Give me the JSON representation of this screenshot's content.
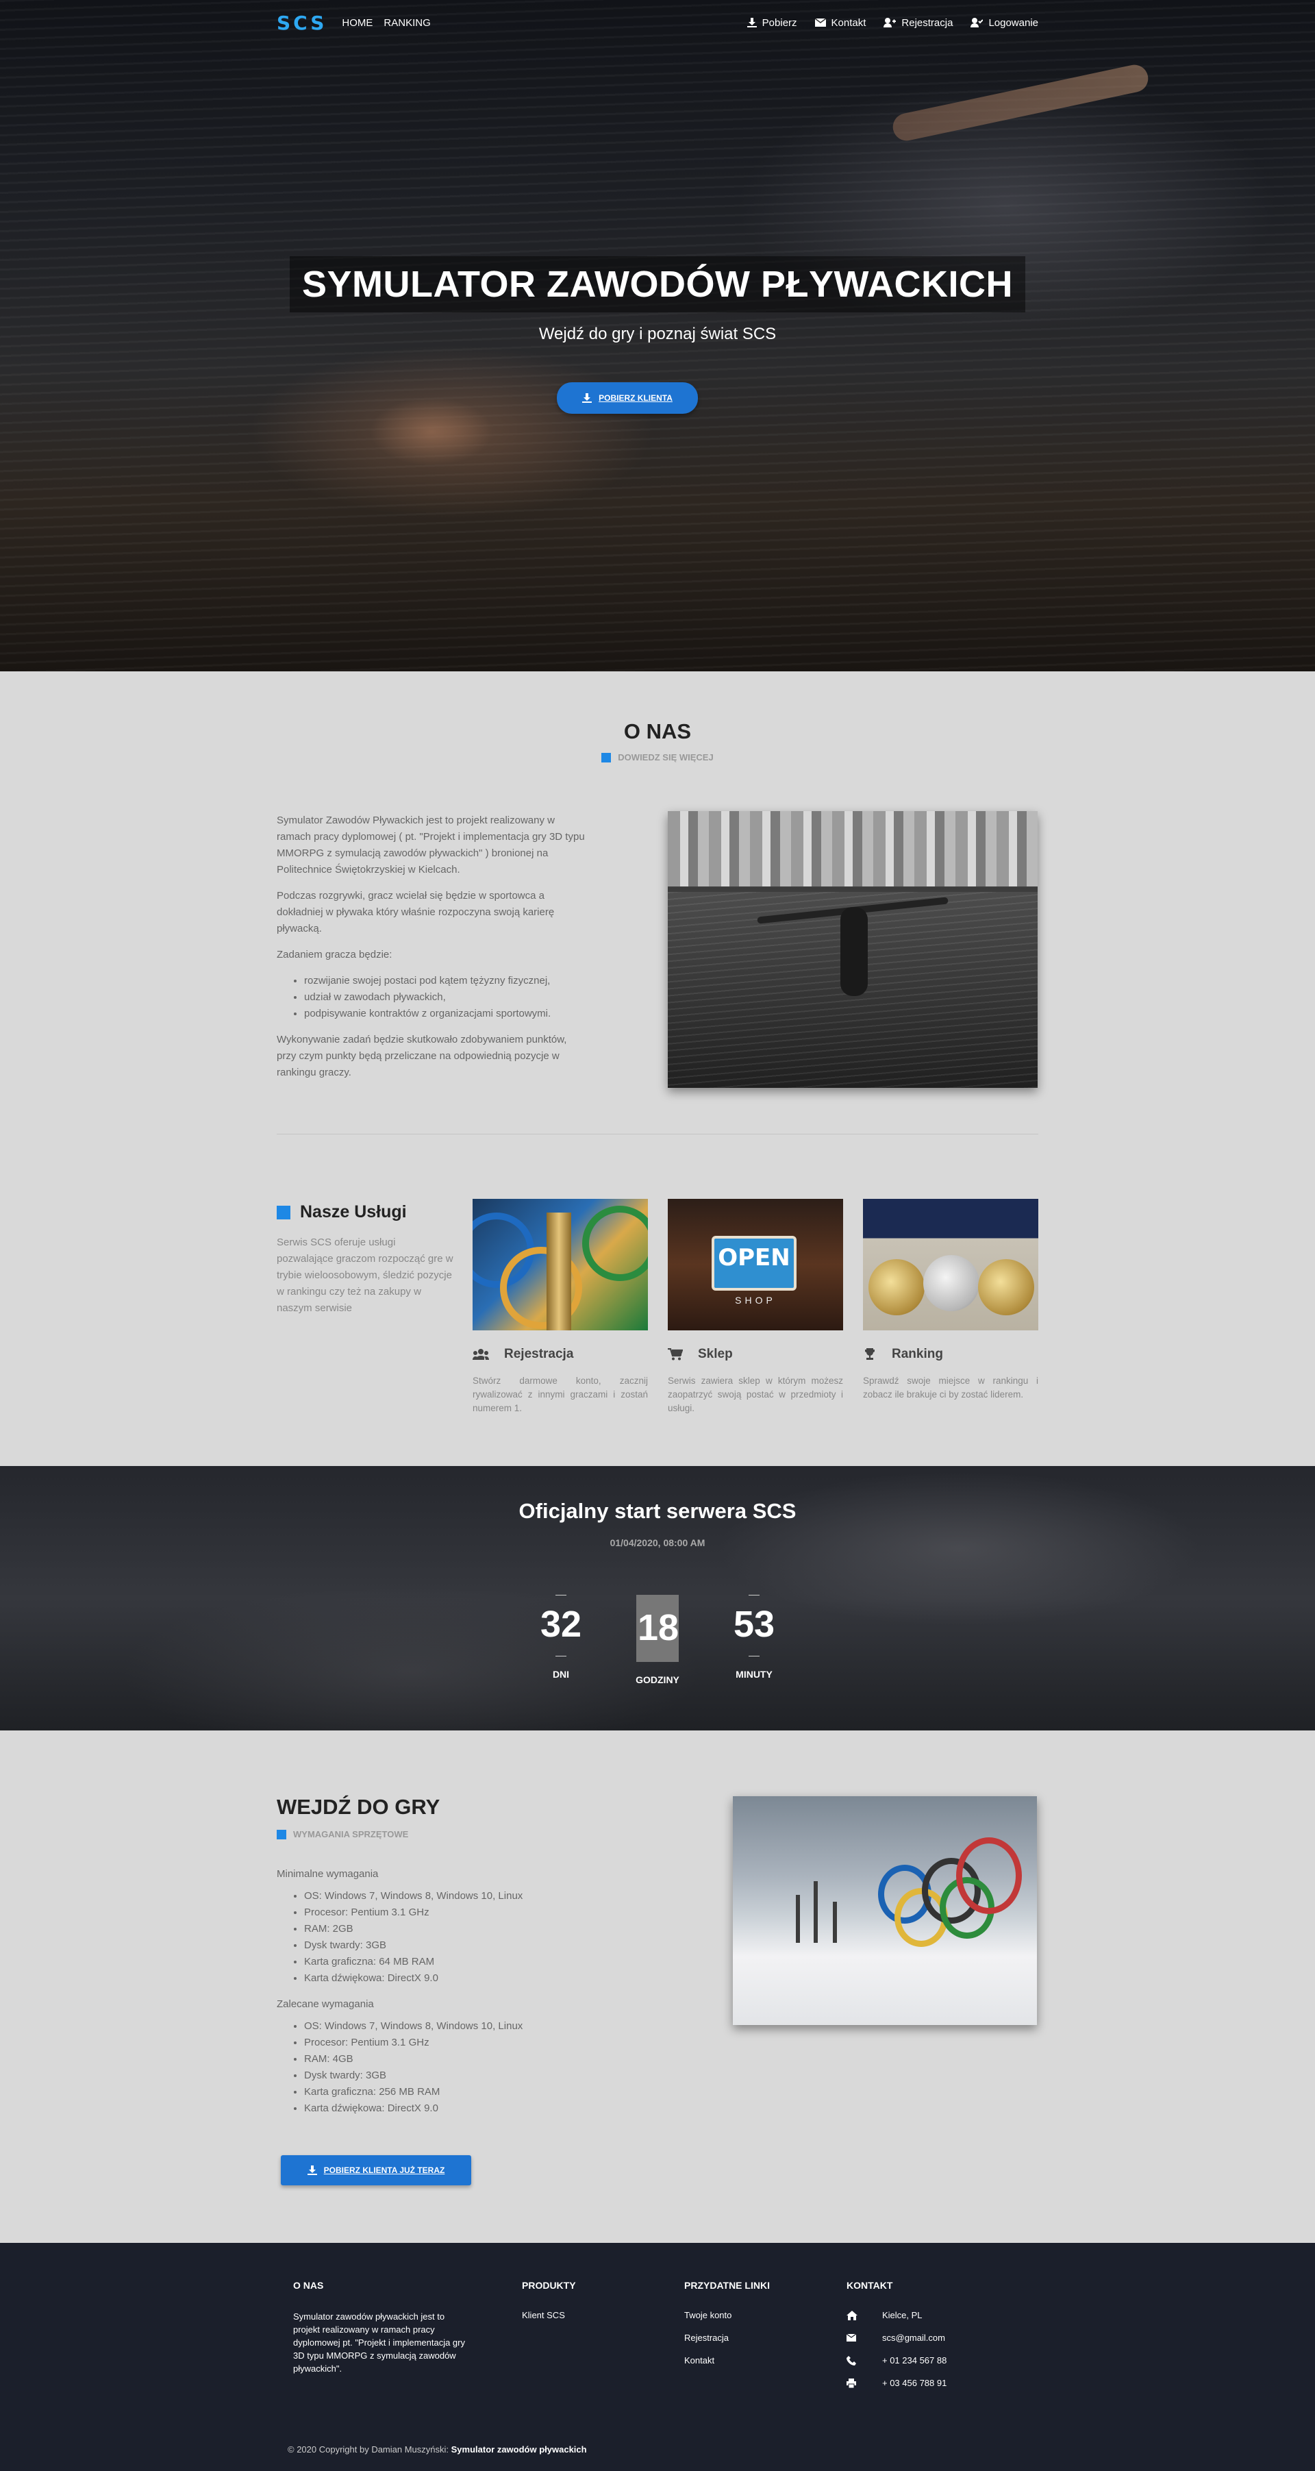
{
  "nav": {
    "logo": "SCS",
    "links": [
      "HOME",
      "RANKING"
    ],
    "right": [
      {
        "label": "Pobierz",
        "icon": "download-icon"
      },
      {
        "label": "Kontakt",
        "icon": "envelope-icon"
      },
      {
        "label": "Rejestracja",
        "icon": "user-plus-icon"
      },
      {
        "label": "Logowanie",
        "icon": "user-check-icon"
      }
    ]
  },
  "hero": {
    "title": "SYMULATOR ZAWODÓW PŁYWACKICH",
    "subtitle": "Wejdź do gry i poznaj świat SCS",
    "button": "POBIERZ KLIENTA"
  },
  "about": {
    "title": "O NAS",
    "subtitle": "DOWIEDZ SIĘ WIĘCEJ",
    "p1": "Symulator Zawodów Pływackich jest to projekt realizowany w ramach pracy dyplomowej ( pt. \"Projekt i implementacja gry 3D typu MMORPG z symulacją zawodów pływackich\" ) bronionej na Politechnice Świętokrzyskiej w Kielcach.",
    "p2": "Podczas rozgrywki, gracz wcielał się będzie w sportowca a dokładniej w pływaka który właśnie rozpoczyna swoją karierę pływacką.",
    "p3": "Zadaniem gracza będzie:",
    "list": [
      "rozwijanie swojej postaci pod kątem tężyzny fizycznej,",
      "udział w zawodach pływackich,",
      "podpisywanie kontraktów z organizacjami sportowymi."
    ],
    "p4": "Wykonywanie zadań będzie skutkowało zdobywaniem punktów, przy czym punkty będą przeliczane na odpowiednią pozycje w rankingu graczy."
  },
  "services": {
    "title": "Nasze Usługi",
    "desc": "Serwis SCS oferuje usługi pozwalające graczom rozpocząć gre w trybie wieloosobowym, śledzić pozycje w rankingu czy też na zakupy w naszym serwisie",
    "items": [
      {
        "title": "Rejestracja",
        "icon": "users-icon",
        "text": "Stwórz darmowe konto, zacznij rywalizować z innymi graczami i zostań numerem 1."
      },
      {
        "title": "Sklep",
        "icon": "cart-icon",
        "text": "Serwis zawiera sklep w którym możesz zaopatrzyć swoją postać w przedmioty i usługi.",
        "sign": "OPEN",
        "sign_sub": "SHOP"
      },
      {
        "title": "Ranking",
        "icon": "trophy-icon",
        "text": "Sprawdź swoje miejsce w rankingu i zobacz ile brakuje ci by zostać liderem."
      }
    ]
  },
  "countdown": {
    "title": "Oficjalny start serwera SCS",
    "date": "01/04/2020, 08:00 AM",
    "units": [
      {
        "value": "32",
        "label": "DNI"
      },
      {
        "value": "18",
        "label": "GODZINY"
      },
      {
        "value": "53",
        "label": "MINUTY"
      }
    ]
  },
  "game": {
    "title": "WEJDŹ DO GRY",
    "subtitle": "WYMAGANIA SPRZĘTOWE",
    "min_title": "Minimalne wymagania",
    "min": [
      "OS: Windows 7, Windows 8, Windows 10, Linux",
      "Procesor: Pentium 3.1 GHz",
      "RAM: 2GB",
      "Dysk twardy: 3GB",
      "Karta graficzna: 64 MB RAM",
      "Karta dźwiękowa: DirectX 9.0"
    ],
    "rec_title": "Zalecane wymagania",
    "rec": [
      "OS: Windows 7, Windows 8, Windows 10, Linux",
      "Procesor: Pentium 3.1 GHz",
      "RAM: 4GB",
      "Dysk twardy: 3GB",
      "Karta graficzna: 256 MB RAM",
      "Karta dźwiękowa: DirectX 9.0"
    ],
    "button": "POBIERZ KLIENTA JUŻ TERAZ"
  },
  "footer": {
    "about_title": "O NAS",
    "about_text": "Symulator zawodów pływackich jest to projekt realizowany w ramach pracy dyplomowej pt. \"Projekt i implementacja gry 3D typu MMORPG z symulacją zawodów pływackich\".",
    "products_title": "PRODUKTY",
    "products": [
      "Klient SCS"
    ],
    "links_title": "PRZYDATNE LINKI",
    "links": [
      "Twoje konto",
      "Rejestracja",
      "Kontakt"
    ],
    "contact_title": "KONTAKT",
    "contact": [
      {
        "icon": "home-icon",
        "text": "Kielce, PL"
      },
      {
        "icon": "envelope-icon",
        "text": "scs@gmail.com"
      },
      {
        "icon": "phone-icon",
        "text": "+ 01 234 567 88"
      },
      {
        "icon": "print-icon",
        "text": "+ 03 456 788 91"
      }
    ],
    "copyright_prefix": "© 2020 Copyright by Damian Muszyński:",
    "copyright_name": "Symulator zawodów pływackich"
  },
  "colors": {
    "accent": "#1e74d2",
    "logo": "#2ea8f2",
    "footer_bg": "#1b1f2b",
    "page_bg": "#d9d9d9"
  }
}
